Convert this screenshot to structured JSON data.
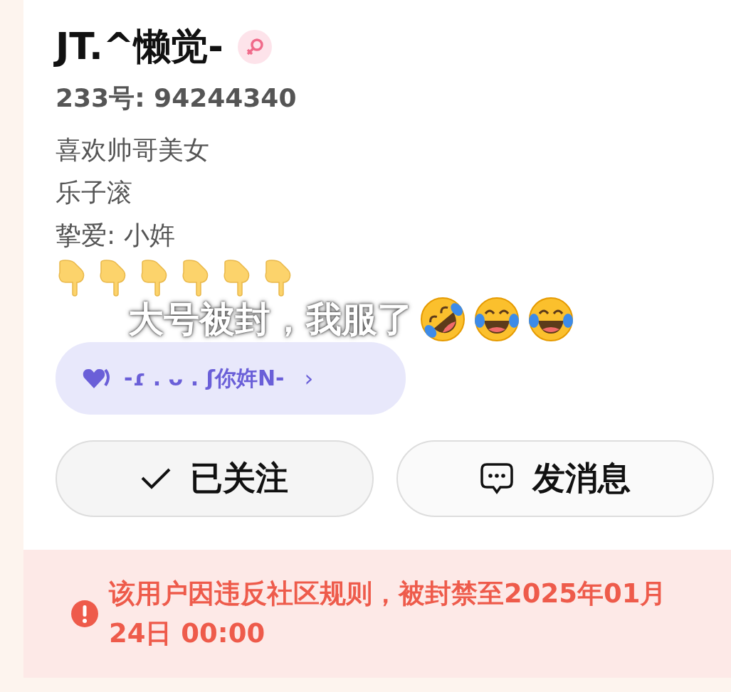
{
  "profile": {
    "name": "JT.^懒觉-",
    "badge": {
      "kind": "female"
    },
    "id_line": "233号: 94244340",
    "bio": [
      "喜欢帅哥美女",
      "乐子滚",
      "挚爱: 小姩"
    ],
    "bio_emojis": [
      {
        "kind": "pointing-down"
      },
      {
        "kind": "pointing-down"
      },
      {
        "kind": "pointing-down"
      },
      {
        "kind": "pointing-down"
      },
      {
        "kind": "pointing-down"
      },
      {
        "kind": "pointing-down"
      }
    ],
    "relation_pill": {
      "text": "-ɾ . ᴗ . ʃ你姩N-",
      "arrow": "›"
    }
  },
  "buttons": [
    {
      "kind": "following",
      "label": "已关注"
    },
    {
      "kind": "message",
      "label": "发消息"
    }
  ],
  "ban_notice": {
    "text": "该用户因违反社区规则，被封禁至2025年01月24日 00:00"
  },
  "caption": {
    "text": "大号被封，我服了",
    "emojis": [
      {
        "kind": "rolling-laugh"
      },
      {
        "kind": "tears-of-joy"
      },
      {
        "kind": "tears-of-joy"
      }
    ]
  }
}
